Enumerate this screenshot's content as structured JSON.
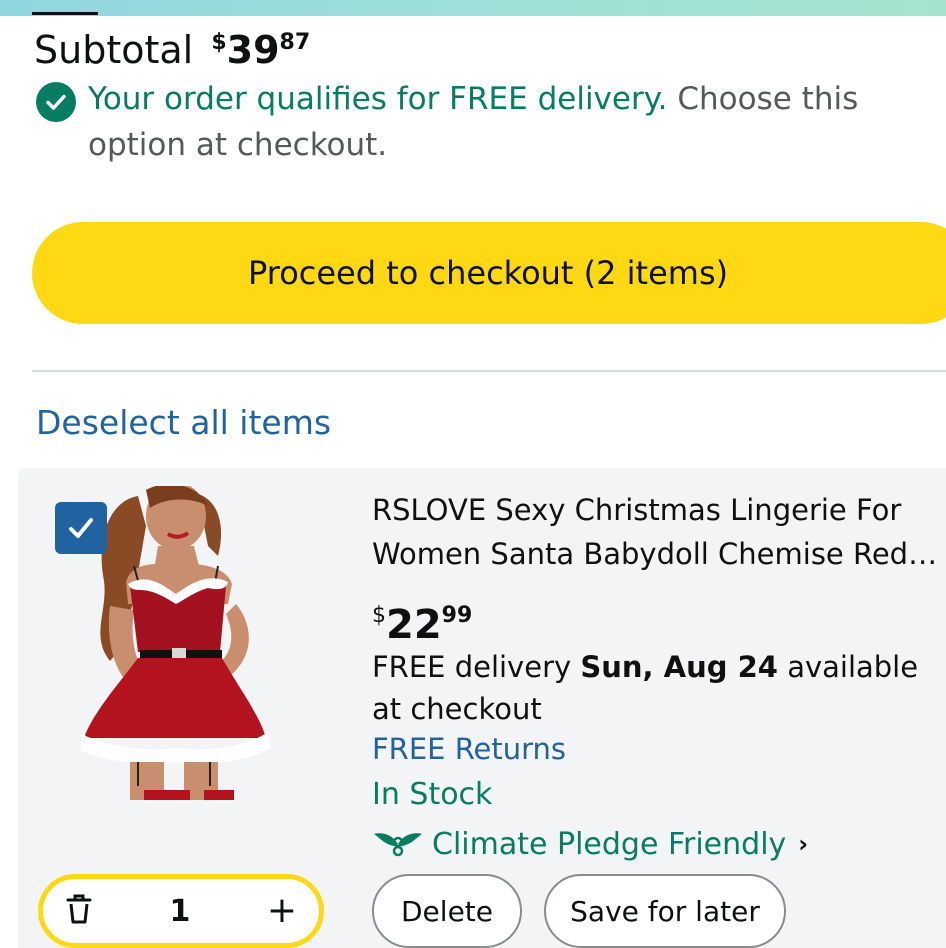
{
  "subtotal": {
    "label": "Subtotal",
    "currency": "$",
    "whole": "39",
    "fraction": "87"
  },
  "free_delivery": {
    "qualify_text": "Your order qualifies for FREE delivery.",
    "instruction": "Choose this option at checkout."
  },
  "checkout_button": {
    "label": "Proceed to checkout (2 items)"
  },
  "deselect_link": "Deselect all items",
  "cart_item": {
    "selected": true,
    "title_line1": "RSLOVE Sexy Christmas Lingerie For",
    "title_line2": "Women Santa Babydoll Chemise Red…",
    "price": {
      "currency": "$",
      "whole": "22",
      "fraction": "99"
    },
    "delivery_prefix": "FREE delivery",
    "delivery_date": "Sun, Aug 24",
    "delivery_suffix": "available at checkout",
    "returns": "FREE Returns",
    "stock": "In Stock",
    "climate": "Climate Pledge Friendly",
    "climate_chevron": "›",
    "quantity": "1",
    "plus_symbol": "+",
    "delete_label": "Delete",
    "save_label": "Save for later"
  },
  "icons": {
    "check": "check-circle-icon",
    "checkbox": "checkbox-checked-icon",
    "trash": "trash-icon",
    "climate": "climate-pledge-icon"
  },
  "colors": {
    "accent_yellow": "#ffd814",
    "link_blue": "#2162a1",
    "success_green": "#067d62",
    "text_dark": "#0f1111",
    "text_muted": "#565959",
    "card_bg": "#f3f4f6"
  }
}
